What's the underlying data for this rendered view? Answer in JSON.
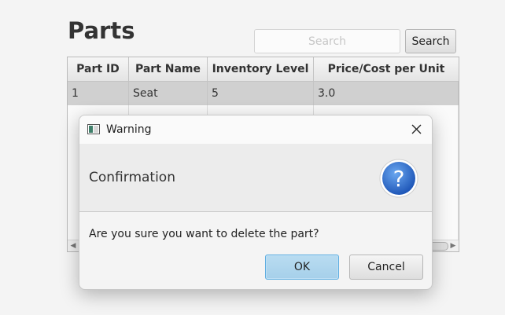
{
  "page": {
    "title": "Parts",
    "search": {
      "placeholder": "Search",
      "value": ""
    },
    "search_button_label": "Search"
  },
  "table": {
    "columns": [
      "Part ID",
      "Part Name",
      "Inventory Level",
      "Price/Cost per Unit"
    ],
    "rows": [
      {
        "id": "1",
        "name": "Seat",
        "inventory": "5",
        "price": "3.0",
        "selected": true
      }
    ]
  },
  "dialog": {
    "window_title": "Warning",
    "header_text": "Confirmation",
    "message": "Are you sure you want to delete the part?",
    "ok_label": "OK",
    "cancel_label": "Cancel",
    "header_icon": "question-icon",
    "accent_color": "#2f6bc4"
  }
}
